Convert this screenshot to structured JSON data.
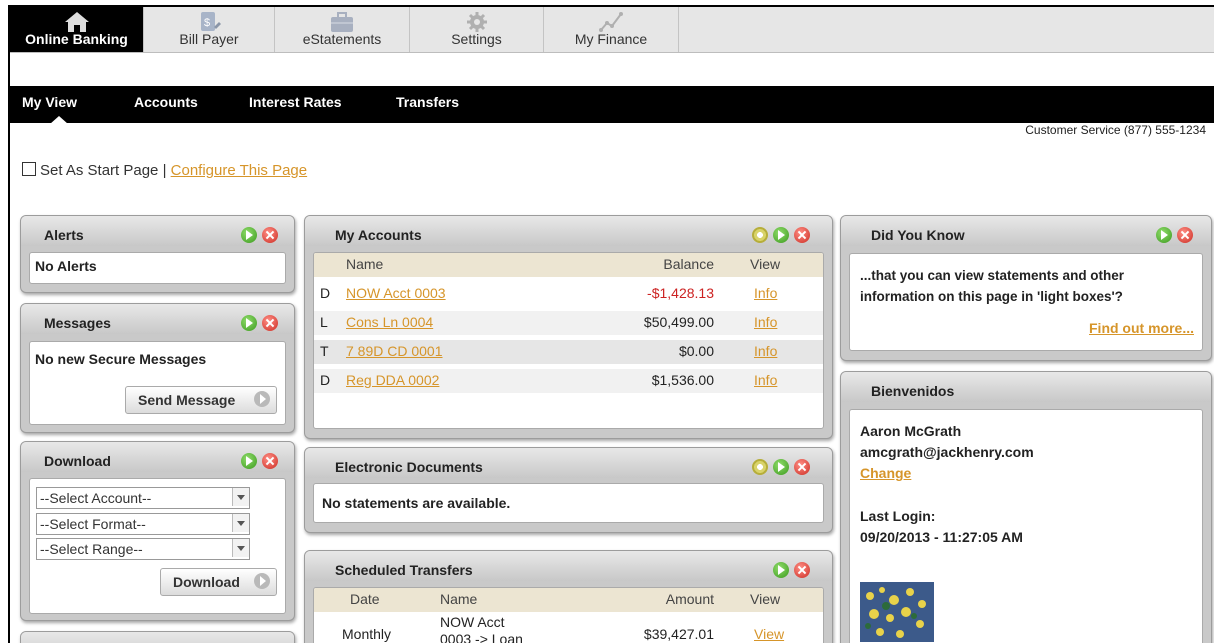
{
  "top_tabs": [
    {
      "label": "Online Banking",
      "icon": "home-icon"
    },
    {
      "label": "Bill Payer",
      "icon": "bill-icon"
    },
    {
      "label": "eStatements",
      "icon": "briefcase-icon"
    },
    {
      "label": "Settings",
      "icon": "gear-icon"
    },
    {
      "label": "My Finance",
      "icon": "chart-line-icon"
    }
  ],
  "sub_nav": [
    "My View",
    "Accounts",
    "Interest Rates",
    "Transfers"
  ],
  "customer_service": "Customer Service (877) 555-1234",
  "start_page": {
    "label": "Set As Start Page |",
    "configure": "Configure This Page"
  },
  "alerts": {
    "title": "Alerts",
    "text": "No Alerts"
  },
  "messages": {
    "title": "Messages",
    "text": "No new Secure Messages",
    "button": "Send Message"
  },
  "download": {
    "title": "Download",
    "account": "--Select Account--",
    "format": "--Select Format--",
    "range": "--Select Range--",
    "button": "Download"
  },
  "my_accounts": {
    "title": "My Accounts",
    "headers": {
      "name": "Name",
      "balance": "Balance",
      "view": "View"
    },
    "rows": [
      {
        "type": "D",
        "name": "NOW Acct 0003",
        "balance": "-$1,428.13",
        "view": "Info"
      },
      {
        "type": "L",
        "name": "Cons Ln 0004",
        "balance": "$50,499.00",
        "view": "Info"
      },
      {
        "type": "T",
        "name": "7 89D CD 0001",
        "balance": "$0.00",
        "view": "Info"
      },
      {
        "type": "D",
        "name": "Reg DDA 0002",
        "balance": "$1,536.00",
        "view": "Info"
      }
    ]
  },
  "edocs": {
    "title": "Electronic Documents",
    "text": "No statements are available."
  },
  "scheduled": {
    "title": "Scheduled Transfers",
    "headers": {
      "date": "Date",
      "name": "Name",
      "amount": "Amount",
      "view": "View"
    },
    "row": {
      "date": "Monthly",
      "name1": "NOW Acct",
      "name2": "0003 -> Loan",
      "amount": "$39,427.01",
      "view": "View"
    }
  },
  "did_you_know": {
    "title": "Did You Know",
    "line1": "...that you can view statements and other",
    "line2": "information on this page in 'light boxes'?",
    "link": "Find out more..."
  },
  "welcome": {
    "title": "Bienvenidos",
    "name": "Aaron McGrath",
    "email": "amcgrath@jackhenry.com",
    "change": "Change",
    "last_login_label": "Last Login:",
    "last_login_date": "09/20/2013 - ",
    "last_login_time": "11:27:05 AM"
  },
  "colors": {
    "link": "#d6952a",
    "negative": "#cc2222",
    "active_tab": "#000000"
  }
}
